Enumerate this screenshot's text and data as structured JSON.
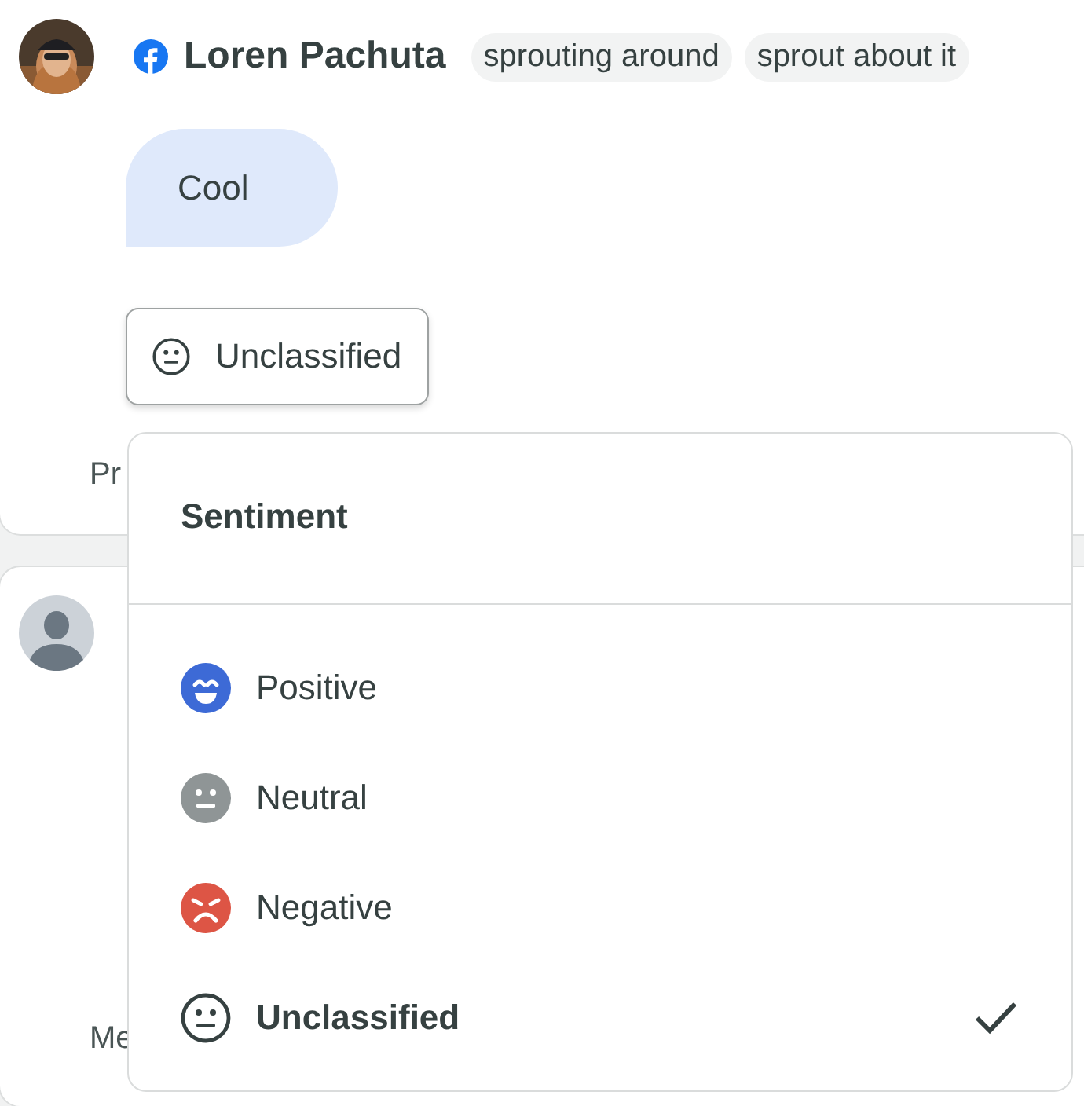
{
  "post": {
    "author": {
      "name": "Loren Pachuta"
    },
    "tags": [
      "sprouting around",
      "sprout about it"
    ],
    "message": "Cool",
    "sentiment_button": {
      "label": "Unclassified",
      "kind": "unclassified"
    },
    "footer_text": "Pr"
  },
  "second_post": {
    "footer_text": "Me"
  },
  "sentiment_menu": {
    "title": "Sentiment",
    "options": [
      {
        "label": "Positive",
        "kind": "positive",
        "selected": false
      },
      {
        "label": "Neutral",
        "kind": "neutral",
        "selected": false
      },
      {
        "label": "Negative",
        "kind": "negative",
        "selected": false
      },
      {
        "label": "Unclassified",
        "kind": "unclassified",
        "selected": true
      }
    ]
  }
}
